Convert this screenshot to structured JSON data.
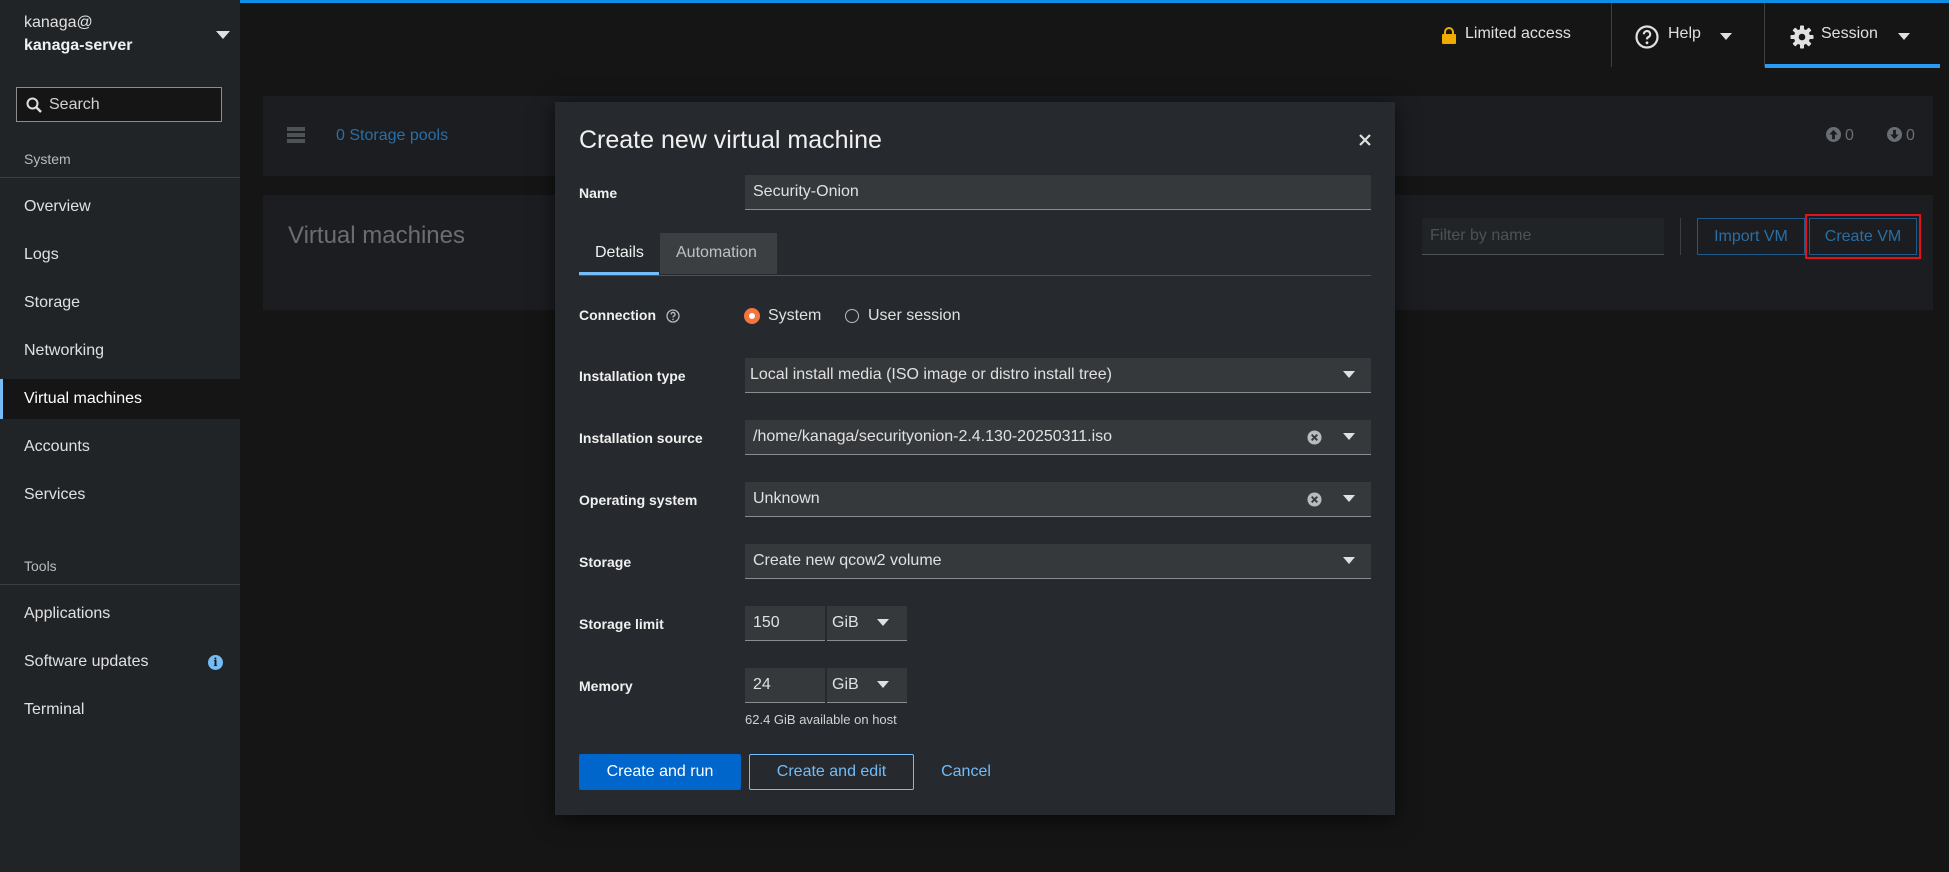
{
  "sidebar": {
    "host_user": "kanaga@",
    "host_name": "kanaga-server",
    "search_placeholder": "Search",
    "system_heading": "System",
    "tools_heading": "Tools",
    "items": [
      {
        "label": "Overview"
      },
      {
        "label": "Logs"
      },
      {
        "label": "Storage"
      },
      {
        "label": "Networking"
      },
      {
        "label": "Virtual machines"
      },
      {
        "label": "Accounts"
      },
      {
        "label": "Services"
      }
    ],
    "tools": [
      {
        "label": "Applications"
      },
      {
        "label": "Software updates",
        "badge": "i"
      },
      {
        "label": "Terminal"
      }
    ],
    "active_item": "Virtual machines"
  },
  "masthead": {
    "limited_access": "Limited access",
    "help": "Help",
    "session": "Session"
  },
  "background": {
    "storage_pools_link": "0 Storage pools",
    "network_up": "0",
    "network_down": "0",
    "vm_title": "Virtual machines",
    "filter_placeholder": "Filter by name",
    "import_vm": "Import VM",
    "create_vm": "Create VM"
  },
  "modal": {
    "title": "Create new virtual machine",
    "name_label": "Name",
    "name_value": "Security-Onion",
    "tabs": [
      {
        "label": "Details",
        "active": true
      },
      {
        "label": "Automation",
        "active": false
      }
    ],
    "connection_label": "Connection",
    "connection_options": [
      {
        "label": "System",
        "selected": true
      },
      {
        "label": "User session",
        "selected": false
      }
    ],
    "installation_type_label": "Installation type",
    "installation_type_value": "Local install media (ISO image or distro install tree)",
    "installation_source_label": "Installation source",
    "installation_source_value": "/home/kanaga/securityonion-2.4.130-20250311.iso",
    "os_label": "Operating system",
    "os_value": "Unknown",
    "storage_label": "Storage",
    "storage_value": "Create new qcow2 volume",
    "storage_limit_label": "Storage limit",
    "storage_limit_value": "150",
    "storage_limit_unit": "GiB",
    "memory_label": "Memory",
    "memory_value": "24",
    "memory_unit": "GiB",
    "memory_helper": "62.4 GiB available on host",
    "buttons": {
      "create_and_run": "Create and run",
      "create_and_edit": "Create and edit",
      "cancel": "Cancel"
    }
  },
  "colors": {
    "accent": "#73bcf7",
    "primary_button": "#0066cc",
    "radio_selected": "#f4753d",
    "highlight_box": "#e0121c",
    "lock": "#f0ab00"
  }
}
